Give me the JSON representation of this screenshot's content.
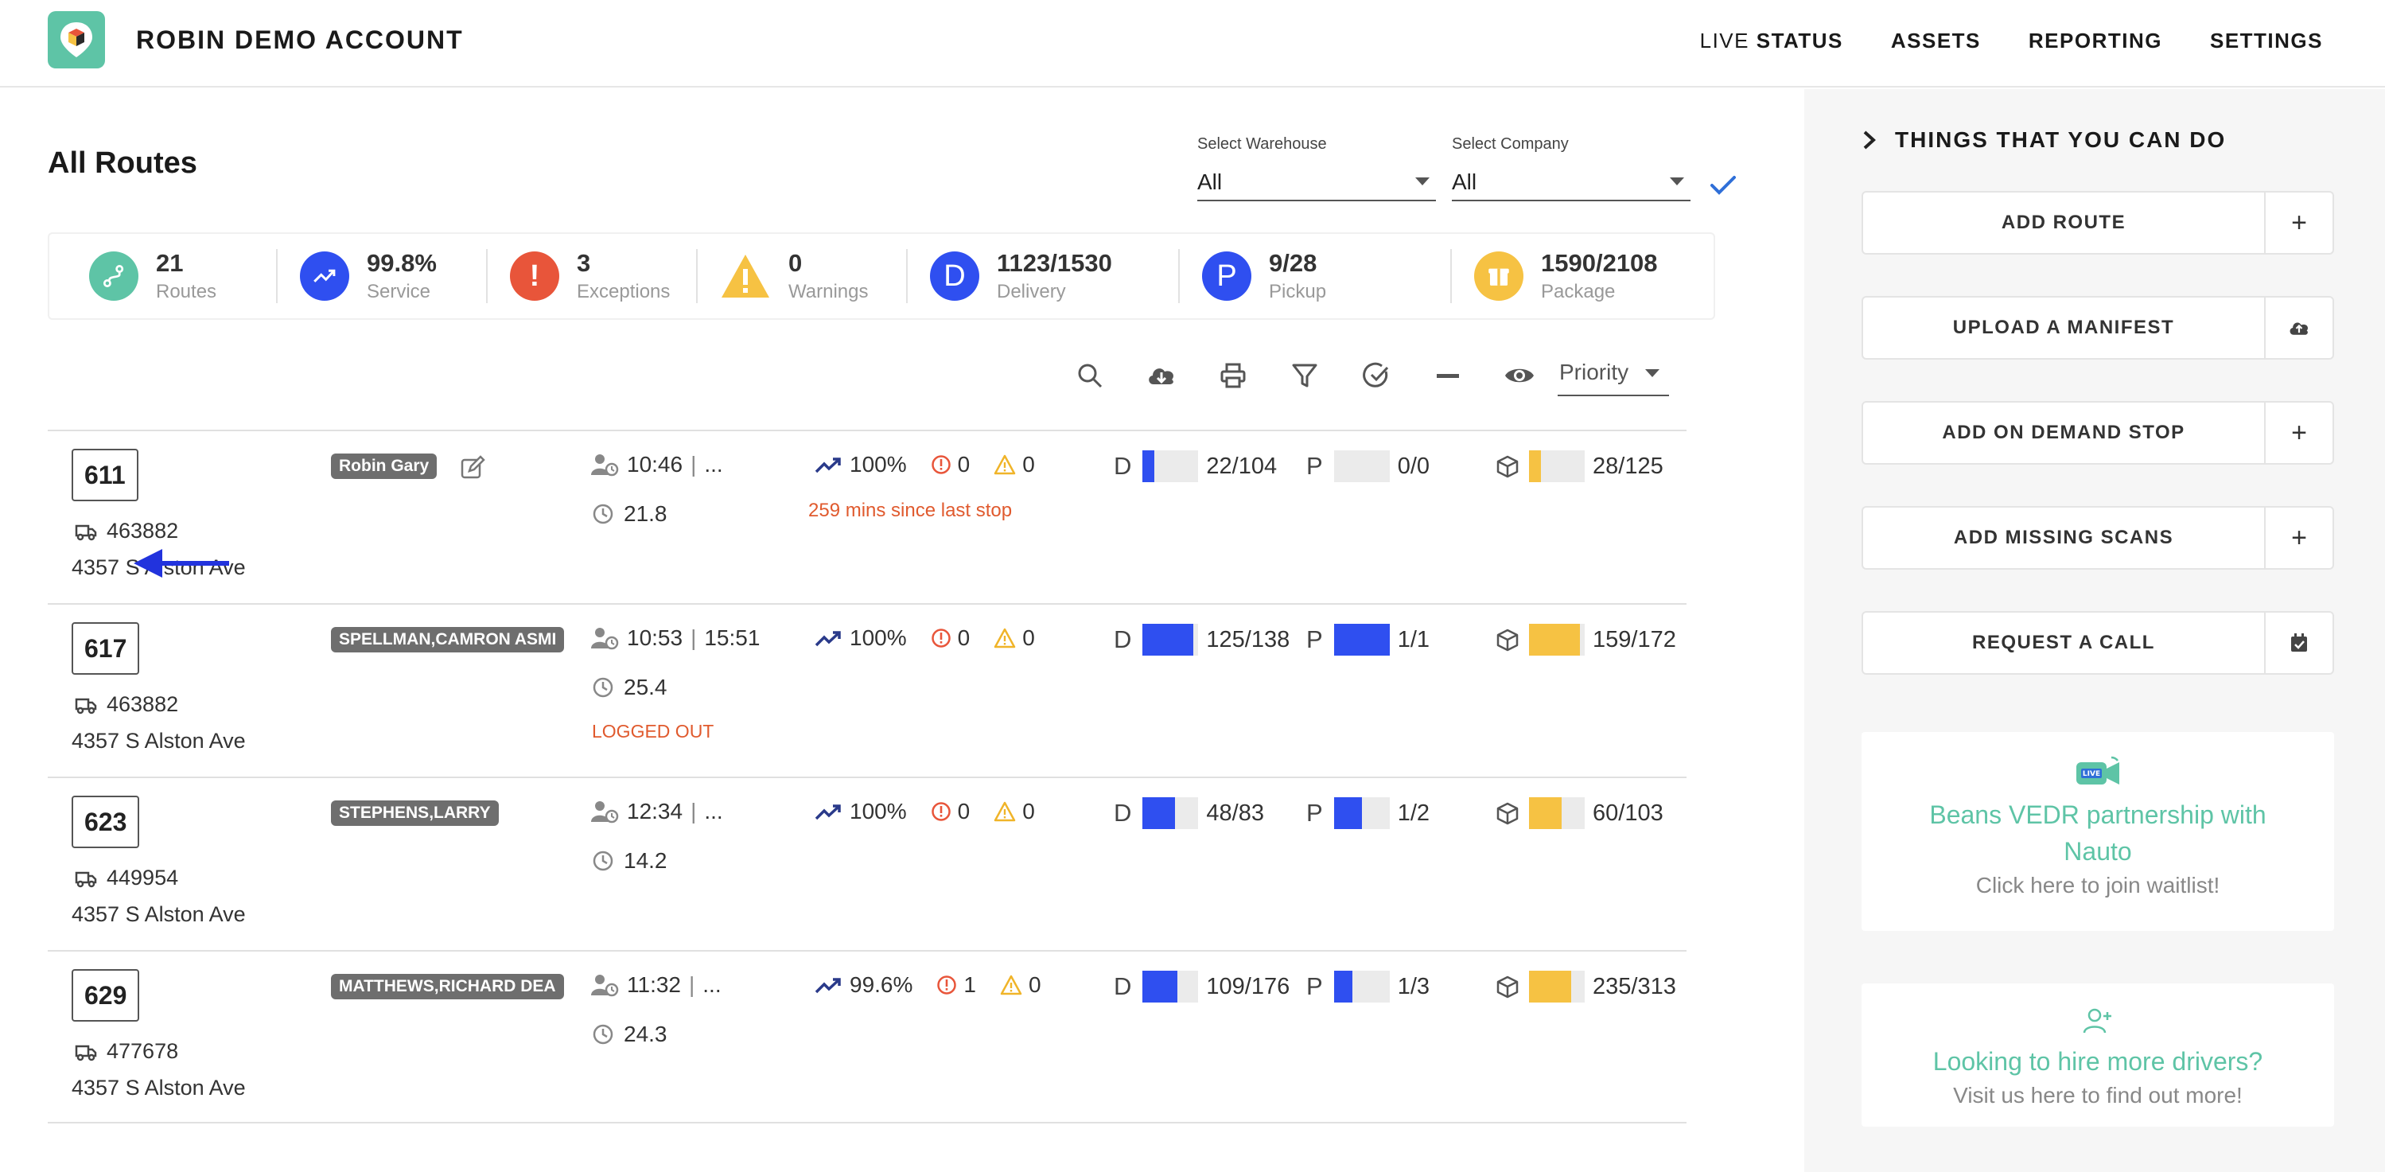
{
  "header": {
    "account_name": "ROBIN DEMO ACCOUNT",
    "nav": {
      "live_prefix": "LIVE",
      "live_status": "STATUS",
      "assets": "ASSETS",
      "reporting": "REPORTING",
      "settings": "SETTINGS"
    }
  },
  "main": {
    "title": "All Routes",
    "warehouse": {
      "label": "Select Warehouse",
      "value": "All"
    },
    "company": {
      "label": "Select Company",
      "value": "All"
    },
    "priority_select": "Priority"
  },
  "stats": [
    {
      "value": "21",
      "label": "Routes",
      "icon": "route-icon",
      "color": "#5ec4a6"
    },
    {
      "value": "99.8%",
      "label": "Service",
      "icon": "trending-up-icon",
      "color": "#2f4ff0"
    },
    {
      "value": "3",
      "label": "Exceptions",
      "icon": "exclamation-icon",
      "color": "#e8553a"
    },
    {
      "value": "0",
      "label": "Warnings",
      "icon": "warning-icon",
      "color": "#f6c243"
    },
    {
      "value": "1123/1530",
      "label": "Delivery",
      "icon": "D",
      "color": "#2f4ff0"
    },
    {
      "value": "9/28",
      "label": "Pickup",
      "icon": "P",
      "color": "#2f4ff0"
    },
    {
      "value": "1590/2108",
      "label": "Package",
      "icon": "package-icon",
      "color": "#f6c243"
    }
  ],
  "routes": [
    {
      "number": "611",
      "truck": "463882",
      "address": "4357 S Alston Ave",
      "driver": "Robin Gary",
      "start": "10:46",
      "end": "...",
      "distance": "21.8",
      "service": "100%",
      "exceptions": "0",
      "warnings": "0",
      "note": "259 mins since last stop",
      "delivery": {
        "letter": "D",
        "text": "22/104",
        "progress": 0.21
      },
      "pickup": {
        "letter": "P",
        "text": "0/0",
        "progress": 0
      },
      "package": {
        "text": "28/125",
        "progress": 0.22
      }
    },
    {
      "number": "617",
      "truck": "463882",
      "address": "4357 S Alston Ave",
      "driver": "SPELLMAN,CAMRON ASMI",
      "start": "10:53",
      "end": "15:51",
      "distance": "25.4",
      "service": "100%",
      "exceptions": "0",
      "warnings": "0",
      "status": "LOGGED OUT",
      "delivery": {
        "letter": "D",
        "text": "125/138",
        "progress": 0.91
      },
      "pickup": {
        "letter": "P",
        "text": "1/1",
        "progress": 1
      },
      "package": {
        "text": "159/172",
        "progress": 0.92
      }
    },
    {
      "number": "623",
      "truck": "449954",
      "address": "4357 S Alston Ave",
      "driver": "STEPHENS,LARRY",
      "start": "12:34",
      "end": "...",
      "distance": "14.2",
      "service": "100%",
      "exceptions": "0",
      "warnings": "0",
      "delivery": {
        "letter": "D",
        "text": "48/83",
        "progress": 0.58
      },
      "pickup": {
        "letter": "P",
        "text": "1/2",
        "progress": 0.5
      },
      "package": {
        "text": "60/103",
        "progress": 0.58
      }
    },
    {
      "number": "629",
      "truck": "477678",
      "address": "4357 S Alston Ave",
      "driver": "MATTHEWS,RICHARD DEA",
      "start": "11:32",
      "end": "...",
      "distance": "24.3",
      "service": "99.6%",
      "exceptions": "1",
      "warnings": "0",
      "delivery": {
        "letter": "D",
        "text": "109/176",
        "progress": 0.62
      },
      "pickup": {
        "letter": "P",
        "text": "1/3",
        "progress": 0.33
      },
      "package": {
        "text": "235/313",
        "progress": 0.75
      }
    }
  ],
  "sidebar": {
    "title": "THINGS THAT YOU CAN DO",
    "actions": [
      {
        "label": "ADD ROUTE",
        "icon": "plus-icon"
      },
      {
        "label": "UPLOAD A MANIFEST",
        "icon": "cloud-upload-icon"
      },
      {
        "label": "ADD ON DEMAND STOP",
        "icon": "plus-icon"
      },
      {
        "label": "ADD MISSING SCANS",
        "icon": "plus-icon"
      },
      {
        "label": "REQUEST A CALL",
        "icon": "calendar-check-icon"
      }
    ],
    "promos": [
      {
        "title": "Beans VEDR partnership with Nauto",
        "subtitle": "Click here to join waitlist!",
        "icon": "live-camera-icon"
      },
      {
        "title": "Looking to hire more drivers?",
        "subtitle": "Visit us here to find out more!",
        "icon": "add-user-icon"
      }
    ]
  },
  "colors": {
    "accent": "#5ec4a6",
    "blue": "#2f4ff0",
    "red": "#e8553a",
    "yellow": "#f6c243",
    "orange_text": "#e05a2e"
  }
}
